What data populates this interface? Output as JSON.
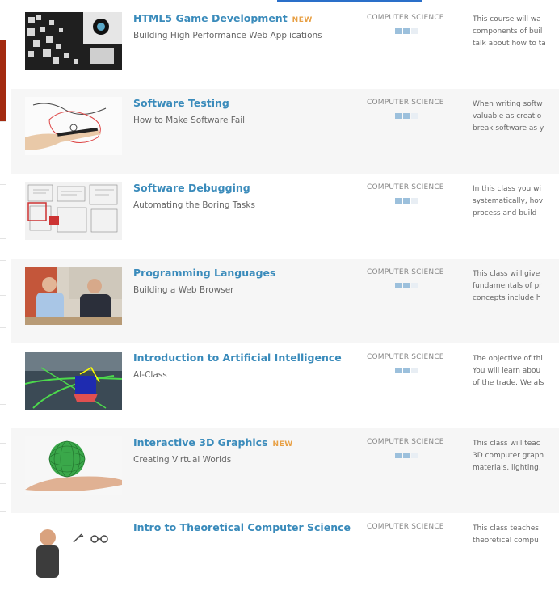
{
  "top_link": "",
  "courses": [
    {
      "title": "HTML5 Game Development",
      "badge": "NEW",
      "subtitle": "Building High Performance Web Applications",
      "category": "COMPUTER SCIENCE",
      "level": 2,
      "desc": [
        "This course will wa",
        "components of buil",
        "talk about how to ta"
      ],
      "thumb_icon": "game-thumbnail"
    },
    {
      "title": "Software Testing",
      "badge": "",
      "subtitle": "How to Make Software Fail",
      "category": "COMPUTER SCIENCE",
      "level": 2,
      "desc": [
        "When writing softw",
        "valuable as creatio",
        "break software as y"
      ],
      "thumb_icon": "hand-drawing-thumbnail"
    },
    {
      "title": "Software Debugging",
      "badge": "",
      "subtitle": "Automating the Boring Tasks",
      "category": "COMPUTER SCIENCE",
      "level": 2,
      "desc": [
        "In this class you wi",
        "systematically, hov",
        "process and build"
      ],
      "thumb_icon": "debug-thumbnail"
    },
    {
      "title": "Programming Languages",
      "badge": "",
      "subtitle": "Building a Web Browser",
      "category": "COMPUTER SCIENCE",
      "level": 2,
      "desc": [
        "This class will give",
        "fundamentals of pr",
        "concepts include h"
      ],
      "thumb_icon": "instructors-thumbnail"
    },
    {
      "title": "Introduction to Artificial Intelligence",
      "badge": "",
      "subtitle": "AI-Class",
      "category": "COMPUTER SCIENCE",
      "level": 2,
      "desc": [
        "The objective of thi",
        "You will learn abou",
        "of the trade. We als"
      ],
      "thumb_icon": "self-driving-car-thumbnail"
    },
    {
      "title": "Interactive 3D Graphics",
      "badge": "NEW",
      "subtitle": "Creating Virtual Worlds",
      "category": "COMPUTER SCIENCE",
      "level": 2,
      "desc": [
        "This class will teac",
        "3D computer graph",
        "materials, lighting,"
      ],
      "thumb_icon": "green-sphere-thumbnail"
    },
    {
      "title": "Intro to Theoretical Computer Science",
      "badge": "",
      "subtitle": "",
      "category": "COMPUTER SCIENCE",
      "level": 2,
      "desc": [
        "This class teaches",
        "theoretical compu"
      ],
      "thumb_icon": "instructor-thumbnail"
    }
  ],
  "colors": {
    "title": "#3a8bbb",
    "new_badge": "#e8a045",
    "level_on": "#9cc0dc",
    "alt_row": "#f6f6f6"
  }
}
